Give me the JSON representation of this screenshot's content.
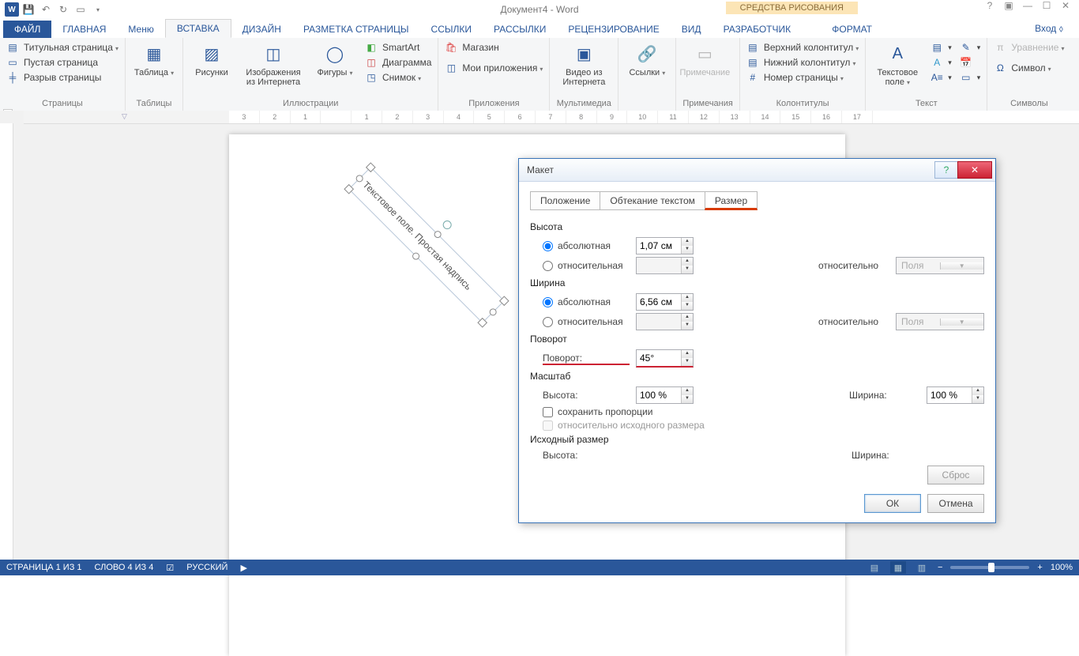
{
  "title": "Документ4 - Word",
  "tool_context": "СРЕДСТВА РИСОВАНИЯ",
  "qat": {
    "undo": "↺",
    "redo": "↻",
    "save": "💾",
    "new": "▭"
  },
  "tabs": {
    "file": "ФАЙЛ",
    "home": "ГЛАВНАЯ",
    "menu": "Меню",
    "insert": "ВСТАВКА",
    "design": "ДИЗАЙН",
    "layout": "РАЗМЕТКА СТРАНИЦЫ",
    "refs": "ССЫЛКИ",
    "mail": "РАССЫЛКИ",
    "review": "РЕЦЕНЗИРОВАНИЕ",
    "view": "ВИД",
    "dev": "РАЗРАБОТЧИК",
    "format": "ФОРМАТ",
    "signin": "Вход"
  },
  "ribbon": {
    "pages": {
      "label": "Страницы",
      "cover": "Титульная страница",
      "blank": "Пустая страница",
      "break": "Разрыв страницы"
    },
    "tables": {
      "label": "Таблицы",
      "table": "Таблица"
    },
    "illus": {
      "label": "Иллюстрации",
      "pics": "Рисунки",
      "online": "Изображения из Интернета",
      "shapes": "Фигуры",
      "smartart": "SmartArt",
      "chart": "Диаграмма",
      "screenshot": "Снимок"
    },
    "apps": {
      "label": "Приложения",
      "store": "Магазин",
      "myapps": "Мои приложения"
    },
    "media": {
      "label": "Мультимедиа",
      "video": "Видео из Интернета"
    },
    "links": {
      "label": "·",
      "link": "Ссылки"
    },
    "comments": {
      "label": "Примечания",
      "comment": "Примечание"
    },
    "header": {
      "label": "Колонтитулы",
      "top": "Верхний колонтитул",
      "bottom": "Нижний колонтитул",
      "page": "Номер страницы"
    },
    "text": {
      "label": "Текст",
      "textbox": "Текстовое поле"
    },
    "symbols": {
      "label": "Символы",
      "eq": "Уравнение",
      "sym": "Символ"
    }
  },
  "textbox_content": "Текстовое поле. Простая надпись",
  "dialog": {
    "title": "Макет",
    "tabs": {
      "pos": "Положение",
      "wrap": "Обтекание текстом",
      "size": "Размер"
    },
    "height": {
      "hdr": "Высота",
      "abs": "абсолютная",
      "rel": "относительная",
      "val": "1,07 см",
      "rel_to": "относительно",
      "margins": "Поля"
    },
    "width": {
      "hdr": "Ширина",
      "abs": "абсолютная",
      "rel": "относительная",
      "val": "6,56 см",
      "rel_to": "относительно",
      "margins": "Поля"
    },
    "rotation": {
      "hdr": "Поворот",
      "label": "Поворот:",
      "val": "45°"
    },
    "scale": {
      "hdr": "Масштаб",
      "h": "Высота:",
      "hv": "100 %",
      "w": "Ширина:",
      "wv": "100 %",
      "lock": "сохранить пропорции",
      "orig": "относительно исходного размера"
    },
    "orig": {
      "hdr": "Исходный размер",
      "h": "Высота:",
      "w": "Ширина:"
    },
    "reset": "Сброс",
    "ok": "ОК",
    "cancel": "Отмена"
  },
  "status": {
    "page": "СТРАНИЦА 1 ИЗ 1",
    "words": "СЛОВО 4 ИЗ 4",
    "lang": "РУССКИЙ",
    "zoom": "100%"
  }
}
